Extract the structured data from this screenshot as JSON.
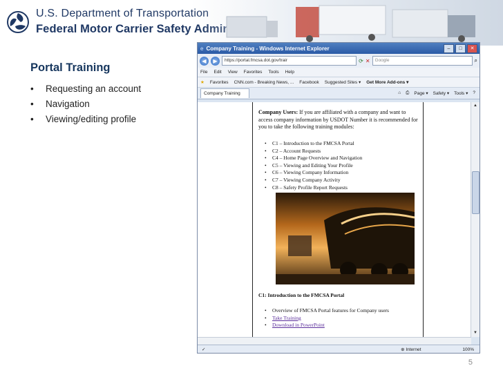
{
  "header": {
    "org_line1": "U.S. Department of Transportation",
    "org_line2": "Federal Motor Carrier Safety Administration",
    "logo_icon": "dot-triskelion-icon"
  },
  "slide": {
    "title": "Portal Training",
    "bullets": [
      "Requesting an account",
      "Navigation",
      "Viewing/editing profile"
    ],
    "page_number": "5"
  },
  "browser": {
    "window_title": "Company Training - Windows Internet Explorer",
    "address": "https://portal.fmcsa.dot.gov/trair",
    "search_placeholder": "Google",
    "menu": [
      "File",
      "Edit",
      "View",
      "Favorites",
      "Tools",
      "Help"
    ],
    "favorites_label": "Favorites",
    "favorites_links": [
      "CNN.com - Breaking News, ...",
      "Facebook",
      "Suggested Sites ▾",
      "Get More Add-ons ▾"
    ],
    "tab_label": "Company Training",
    "tab_tools": [
      "Page ▾",
      "Safety ▾",
      "Tools ▾",
      "?"
    ],
    "status_zone": "Internet",
    "status_zoom": "100%",
    "scroll_up": "▲",
    "scroll_down": "▼"
  },
  "page": {
    "intro_bold": "Company Users:",
    "intro_text": " If you are affiliated with a company and want to access company information by USDOT Number it is recommended for you to take the following training modules:",
    "modules": [
      "C1 – Introduction to the FMCSA Portal",
      "C2 – Account Requests",
      "C4 – Home Page Overview and Navigation",
      "C5 – Viewing and Editing Your Profile",
      "C6 – Viewing Company Information",
      "C7 – Viewing Company Activity",
      "C8 – Safety Profile Report Requests"
    ],
    "c1_heading": "C1: Introduction to the FMCSA Portal",
    "c1_items": [
      "Overview of FMCSA Portal features for Company users",
      "Take Training",
      "Download in PowerPoint"
    ]
  },
  "colors": {
    "title_blue": "#17375e",
    "org_blue": "#1f3864",
    "link_purple": "#5a2d9b"
  }
}
